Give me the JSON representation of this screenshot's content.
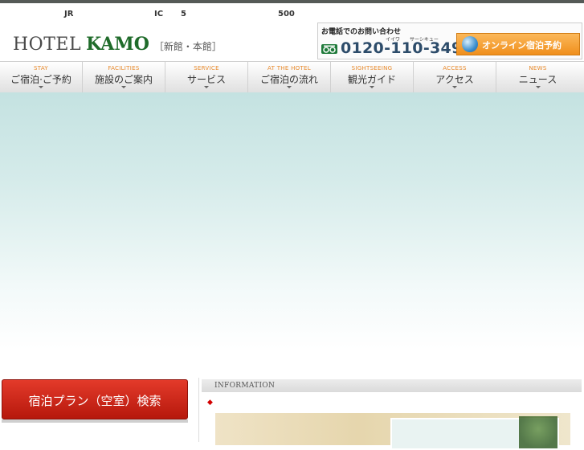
{
  "tagline": {
    "jr": "JR",
    "ic": "IC",
    "five": "5",
    "five_hundred": "500"
  },
  "logo": {
    "word1": "HOTEL",
    "word2": "KAMO",
    "sub": "［新館・本館］"
  },
  "contact": {
    "label": "お電話でのお問い合わせ",
    "ruby": [
      "イイワ",
      "サーシキュー"
    ],
    "freedial_icon": "freedial-icon",
    "number": "0120-110-349"
  },
  "reserve": {
    "label": "オンライン宿泊予約",
    "icon": "globe-icon"
  },
  "nav": [
    {
      "en": "STAY",
      "jp": "ご宿泊·ご予約"
    },
    {
      "en": "FACILITIES",
      "jp": "施設のご案内"
    },
    {
      "en": "SERVICE",
      "jp": "サービス"
    },
    {
      "en": "AT THE HOTEL",
      "jp": "ご宿泊の流れ"
    },
    {
      "en": "SIGHTSEEING",
      "jp": "観光ガイド"
    },
    {
      "en": "ACCESS",
      "jp": "アクセス"
    },
    {
      "en": "NEWS",
      "jp": "ニュース"
    }
  ],
  "search": {
    "label": "宿泊プラン（空室）検索"
  },
  "info": {
    "title": "INFORMATION",
    "bullet": "◆"
  },
  "colors": {
    "brand_green": "#1f6b2a",
    "accent_orange": "#f08f1c",
    "search_red": "#c8200f"
  }
}
